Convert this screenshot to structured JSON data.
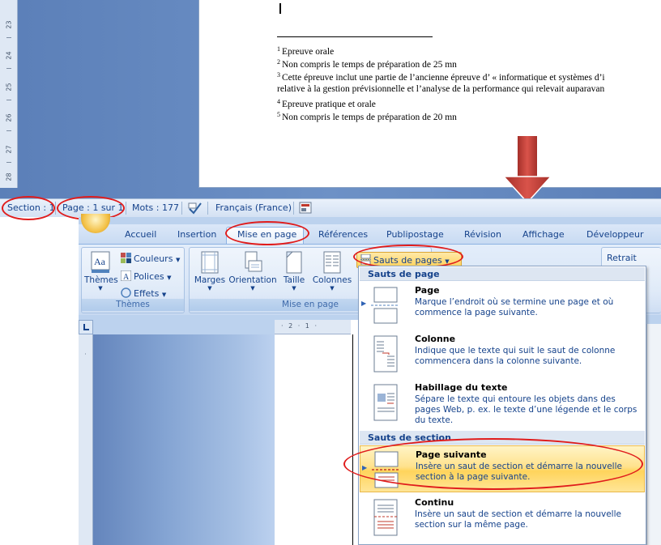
{
  "document_top": {
    "ruler_numbers": [
      "23",
      "24",
      "25",
      "26",
      "27",
      "28"
    ],
    "footnotes": [
      {
        "num": "1",
        "text": "Epreuve orale"
      },
      {
        "num": "2",
        "text": "Non compris le temps de préparation de 25 mn"
      },
      {
        "num": "3",
        "text": "Cette épreuve inclut une partie de l’ancienne épreuve d’ « informatique et systèmes d’i"
      },
      {
        "num": "",
        "text": "relative à la gestion prévisionnelle  et l’analyse de la performance qui relevait auparavan"
      },
      {
        "num": "4",
        "text": "Epreuve pratique et orale"
      },
      {
        "num": "5",
        "text": "Non compris le temps de préparation de 20 mn"
      }
    ]
  },
  "status_bar": {
    "section": "Section : 1",
    "page": "Page : 1 sur 1",
    "words": "Mots : 177",
    "language": "Français (France)"
  },
  "ribbon": {
    "tabs": [
      "Accueil",
      "Insertion",
      "Mise en page",
      "Références",
      "Publipostage",
      "Révision",
      "Affichage",
      "Développeur"
    ],
    "active_tab": "Mise en page",
    "groups": {
      "themes": {
        "label": "Thèmes",
        "big_button": "Thèmes",
        "colors": "Couleurs",
        "fonts": "Polices",
        "effects": "Effets"
      },
      "page_setup": {
        "label": "Mise en page",
        "margins": "Marges",
        "orientation": "Orientation",
        "size": "Taille",
        "columns": "Colonnes",
        "breaks": "Sauts de pages"
      },
      "paragraph": {
        "indent": "Retrait"
      }
    }
  },
  "breaks_menu": {
    "page_breaks_header": "Sauts de page",
    "section_breaks_header": "Sauts de section",
    "items": [
      {
        "title": "Page",
        "desc": "Marque l’endroit où se termine une page et où commence la page suivante."
      },
      {
        "title": "Colonne",
        "desc": "Indique que le texte qui suit le saut de colonne commencera dans la colonne suivante."
      },
      {
        "title": "Habillage du texte",
        "desc": "Sépare le texte qui entoure les objets dans des pages Web, p. ex. le texte d’une légende et le corps du texte."
      },
      {
        "title": "Page suivante",
        "desc": "Insère un saut de section et démarre la nouvelle section à la page suivante."
      },
      {
        "title": "Continu",
        "desc": "Insère un saut de section et démarre la nouvelle section sur la même page."
      }
    ],
    "highlighted": "Page suivante"
  },
  "colors": {
    "annotation_red": "#e01c1c",
    "arrow_red": "#c0392b",
    "ribbon_text": "#15428b",
    "highlight": "#ffd45c"
  }
}
